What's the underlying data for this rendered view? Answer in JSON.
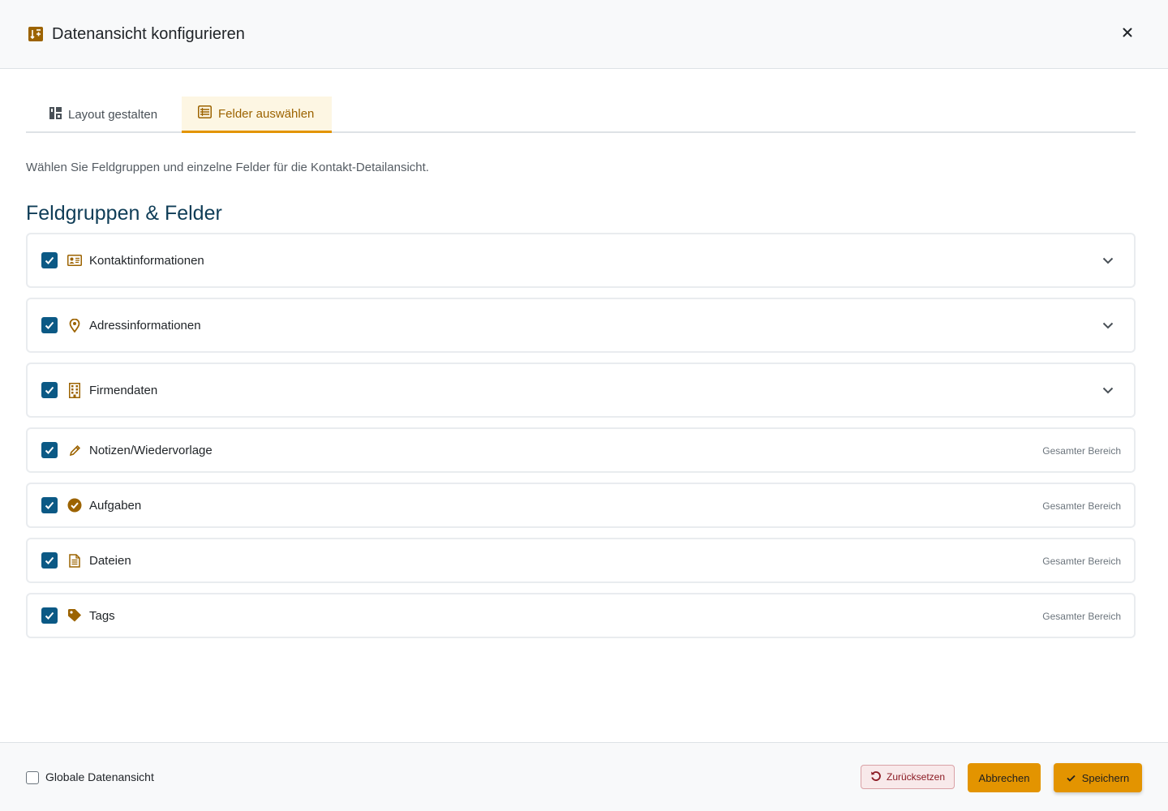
{
  "header": {
    "title": "Datenansicht konfigurieren",
    "icon": "layout-config-icon",
    "close_icon": "close-icon"
  },
  "tabs": [
    {
      "label": "Layout gestalten",
      "icon": "layout-icon",
      "active": false
    },
    {
      "label": "Felder auswählen",
      "icon": "list-icon",
      "active": true
    }
  ],
  "intro": "Wählen Sie Feldgruppen und einzelne Felder für die Kontakt-Detailansicht.",
  "section_title": "Feldgruppen & Felder",
  "groups": [
    {
      "label": "Kontaktinformationen",
      "icon": "contact-card-icon",
      "checked": true,
      "expandable": true,
      "scope": ""
    },
    {
      "label": "Adressinformationen",
      "icon": "map-pin-icon",
      "checked": true,
      "expandable": true,
      "scope": ""
    },
    {
      "label": "Firmendaten",
      "icon": "building-icon",
      "checked": true,
      "expandable": true,
      "scope": ""
    },
    {
      "label": "Notizen/Wiedervorlage",
      "icon": "pencil-icon",
      "checked": true,
      "expandable": false,
      "scope": "Gesamter Bereich"
    },
    {
      "label": "Aufgaben",
      "icon": "check-circle-icon",
      "checked": true,
      "expandable": false,
      "scope": "Gesamter Bereich"
    },
    {
      "label": "Dateien",
      "icon": "file-icon",
      "checked": true,
      "expandable": false,
      "scope": "Gesamter Bereich"
    },
    {
      "label": "Tags",
      "icon": "tag-icon",
      "checked": true,
      "expandable": false,
      "scope": "Gesamter Bereich"
    }
  ],
  "footer": {
    "global_label": "Globale Datenansicht",
    "global_checked": false,
    "reset_label": "Zurücksetzen",
    "cancel_label": "Abbrechen",
    "save_label": "Speichern"
  },
  "colors": {
    "accent": "#e39400",
    "accent_text": "#9c6300",
    "checkbox": "#0b5985",
    "title": "#0f3d57",
    "icon": "#9c6300",
    "reset_text": "#8b1a23"
  }
}
